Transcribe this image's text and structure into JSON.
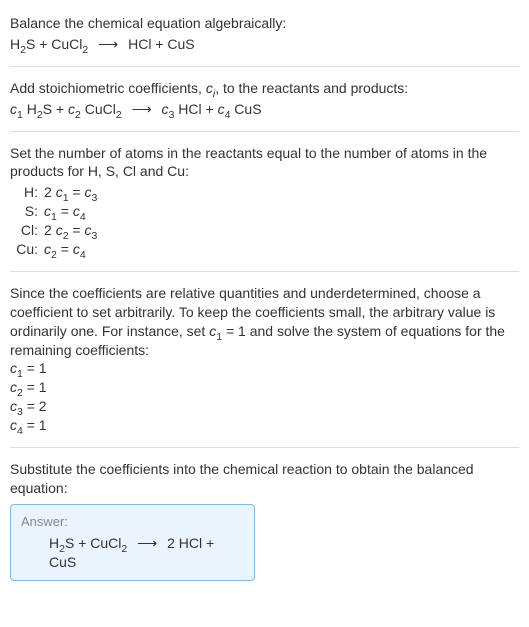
{
  "step1": {
    "intro": "Balance the chemical equation algebraically:",
    "lhs1": "H",
    "lhs1_sub": "2",
    "lhs1b": "S + CuCl",
    "lhs1b_sub": "2",
    "rhs1": "HCl + CuS"
  },
  "step2": {
    "intro_a": "Add stoichiometric coefficients, ",
    "intro_ci": "c",
    "intro_ci_sub": "i",
    "intro_b": ", to the reactants and products:",
    "c1": "c",
    "c1s": "1",
    "t1a": " H",
    "t1as": "2",
    "t1b": "S + ",
    "c2": "c",
    "c2s": "2",
    "t2": " CuCl",
    "t2s": "2",
    "c3": "c",
    "c3s": "3",
    "t3": " HCl + ",
    "c4": "c",
    "c4s": "4",
    "t4": " CuS"
  },
  "step3": {
    "intro": "Set the number of atoms in the reactants equal to the number of atoms in the products for H, S, Cl and Cu:",
    "rows": {
      "H": {
        "sym": "H:",
        "lhs_a": "2 ",
        "lhs_c": "c",
        "lhs_s": "1",
        "eq": " = ",
        "rhs_c": "c",
        "rhs_s": "3"
      },
      "S": {
        "sym": "S:",
        "lhs_a": "",
        "lhs_c": "c",
        "lhs_s": "1",
        "eq": " = ",
        "rhs_c": "c",
        "rhs_s": "4"
      },
      "Cl": {
        "sym": "Cl:",
        "lhs_a": "2 ",
        "lhs_c": "c",
        "lhs_s": "2",
        "eq": " = ",
        "rhs_c": "c",
        "rhs_s": "3"
      },
      "Cu": {
        "sym": "Cu:",
        "lhs_a": "",
        "lhs_c": "c",
        "lhs_s": "2",
        "eq": " = ",
        "rhs_c": "c",
        "rhs_s": "4"
      }
    }
  },
  "step4": {
    "intro_a": "Since the coefficients are relative quantities and underdetermined, choose a coefficient to set arbitrarily. To keep the coefficients small, the arbitrary value is ordinarily one. For instance, set ",
    "intro_c": "c",
    "intro_cs": "1",
    "intro_eq1": " = 1",
    "intro_b": " and solve the system of equations for the remaining coefficients:",
    "lines": {
      "l1": {
        "c": "c",
        "s": "1",
        "v": " = 1"
      },
      "l2": {
        "c": "c",
        "s": "2",
        "v": " = 1"
      },
      "l3": {
        "c": "c",
        "s": "3",
        "v": " = 2"
      },
      "l4": {
        "c": "c",
        "s": "4",
        "v": " = 1"
      }
    }
  },
  "step5": {
    "intro": "Substitute the coefficients into the chemical reaction to obtain the balanced equation:",
    "answer_hdr": "Answer:",
    "final_a": "H",
    "final_as": "2",
    "final_b": "S + CuCl",
    "final_bs": "2",
    "final_rhs": "2 HCl + CuS"
  },
  "arrow": "⟶"
}
